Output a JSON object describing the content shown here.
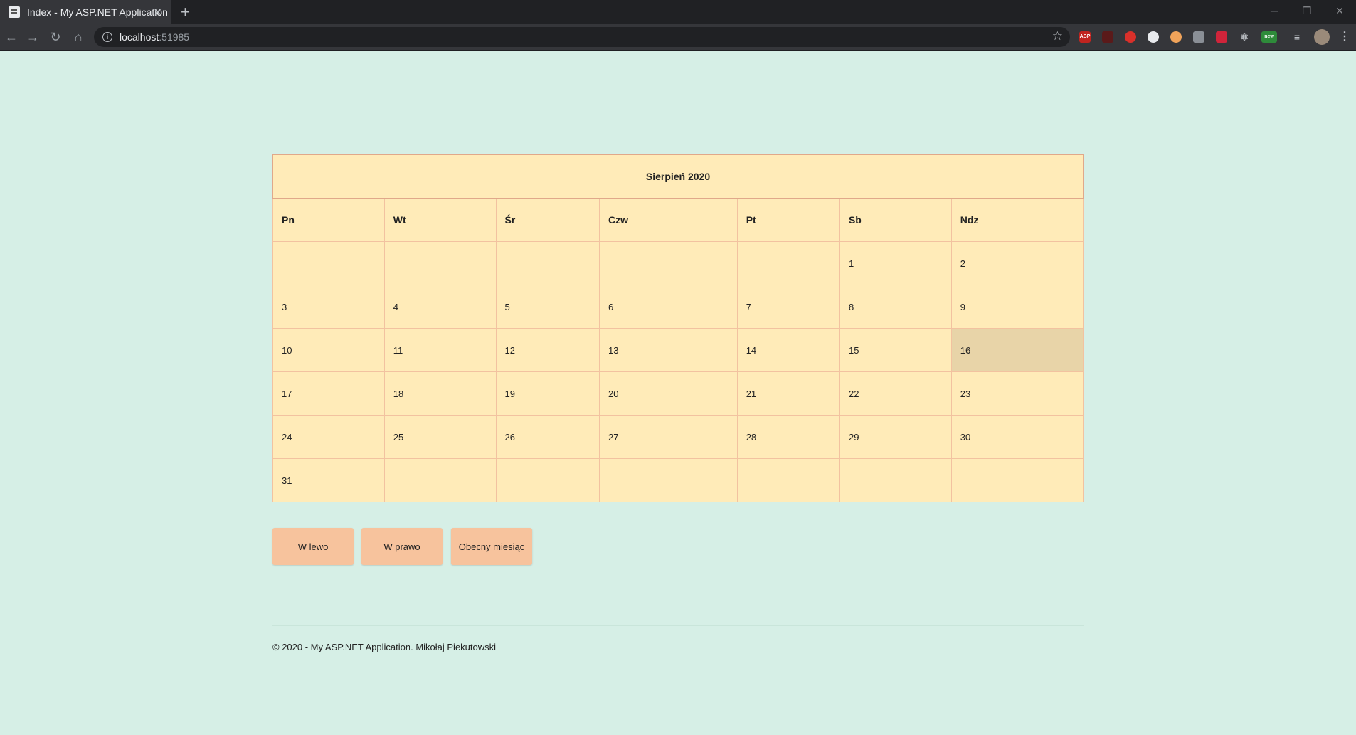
{
  "browser": {
    "tab_title": "Index - My ASP.NET Application",
    "close_glyph": "✕",
    "newtab_glyph": "+",
    "url_host": "localhost",
    "url_port": ":51985",
    "window_controls": [
      "─",
      "❐",
      "✕"
    ]
  },
  "calendar": {
    "title": "Sierpień 2020",
    "weekdays": [
      "Pn",
      "Wt",
      "Śr",
      "Czw",
      "Pt",
      "Sb",
      "Ndz"
    ],
    "weeks": [
      [
        "",
        "",
        "",
        "",
        "",
        "1",
        "2"
      ],
      [
        "3",
        "4",
        "5",
        "6",
        "7",
        "8",
        "9"
      ],
      [
        "10",
        "11",
        "12",
        "13",
        "14",
        "15",
        "16"
      ],
      [
        "17",
        "18",
        "19",
        "20",
        "21",
        "22",
        "23"
      ],
      [
        "24",
        "25",
        "26",
        "27",
        "28",
        "29",
        "30"
      ],
      [
        "31",
        "",
        "",
        "",
        "",
        "",
        ""
      ]
    ],
    "highlighted_day": "16",
    "colors": {
      "cell": "#ffebb8",
      "border": "#f2c2a0",
      "highlight": "#e8d4a8",
      "page_bg": "#d6efe6"
    }
  },
  "buttons": {
    "left": "W lewo",
    "right": "W prawo",
    "current": "Obecny miesiąc",
    "color": "#f7c39d"
  },
  "footer": {
    "text": "© 2020 - My ASP.NET Application. Mikołaj Piekutowski"
  }
}
